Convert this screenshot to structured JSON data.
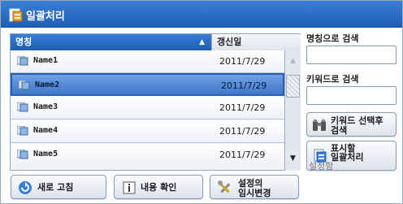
{
  "window": {
    "title": "일괄처리"
  },
  "list": {
    "col_name": "명칭",
    "col_date": "갱신일",
    "sort_indicator": "▲",
    "rows": [
      {
        "name": "Name1",
        "date": "2011/7/29"
      },
      {
        "name": "Name2",
        "date": "2011/7/29"
      },
      {
        "name": "Name3",
        "date": "2011/7/29"
      },
      {
        "name": "Name4",
        "date": "2011/7/29"
      },
      {
        "name": "Name5",
        "date": "2011/7/29"
      }
    ],
    "selected_index": 1,
    "scroll_up": "▲",
    "scroll_down": "▼"
  },
  "search": {
    "by_name_label": "명칭으로 검색",
    "by_name_value": "",
    "by_keyword_label": "키워드로 검색",
    "by_keyword_value": ""
  },
  "buttons": {
    "keyword_select_line1": "키워드 선택후",
    "keyword_select_line2": "검색",
    "show_batch_line1": "표시할",
    "show_batch_line2": "일괄처리",
    "show_batch_line3": "설정함",
    "refresh": "새로 고침",
    "details": "내용 확인",
    "temp_change_line1": "설정의",
    "temp_change_line2": "임시변경"
  }
}
